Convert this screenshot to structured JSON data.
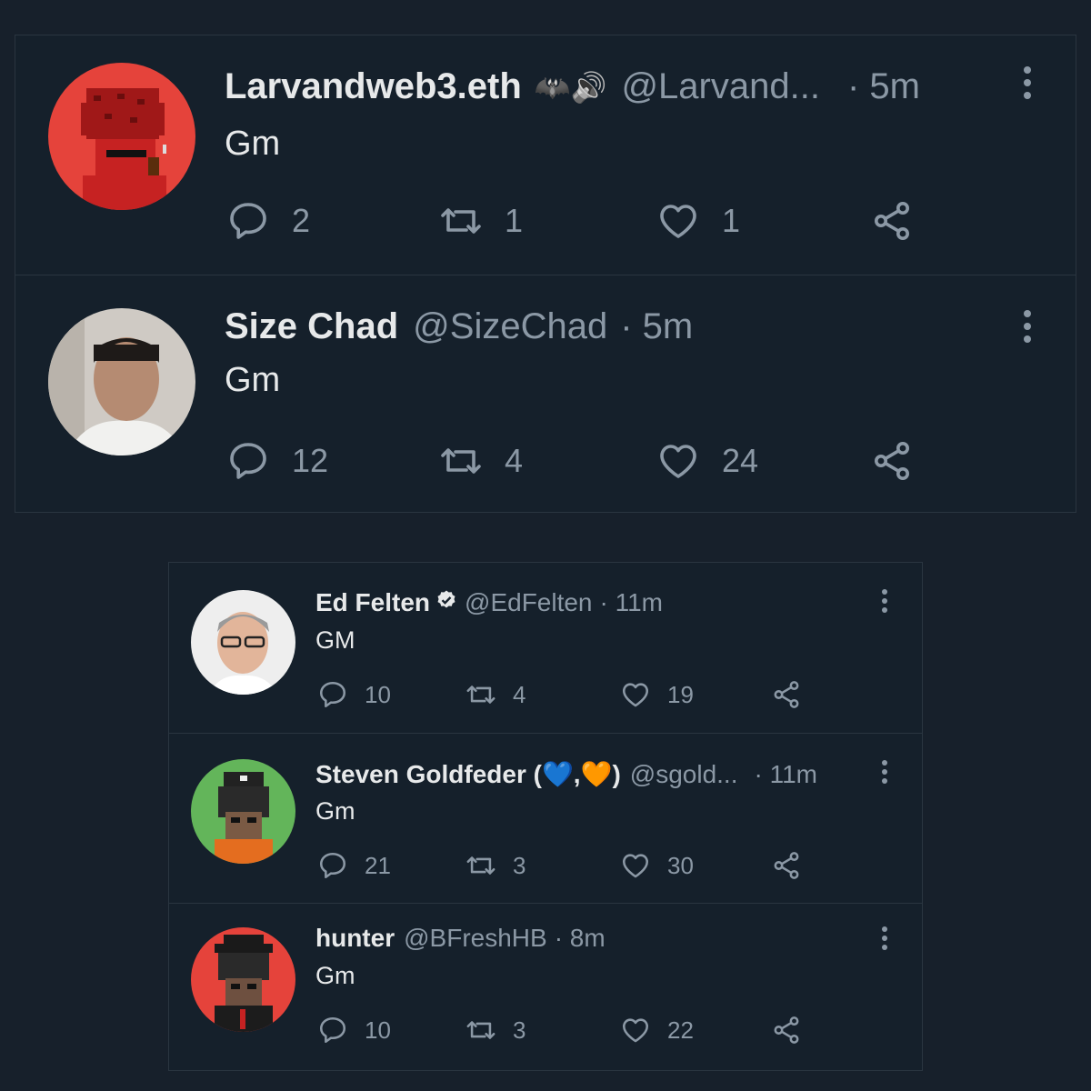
{
  "top_panel": {
    "tweets": [
      {
        "name": "Larvandweb3.eth",
        "name_emoji": "🦇🔊",
        "handle": "@Larvand...",
        "time": "· 5m",
        "text": "Gm",
        "avatar_bg": "#e5433b",
        "counts": {
          "reply": "2",
          "retweet": "1",
          "like": "1"
        }
      },
      {
        "name": "Size Chad",
        "handle": "@SizeChad",
        "time": "· 5m",
        "text": "Gm",
        "avatar_bg": "#9a9088",
        "counts": {
          "reply": "12",
          "retweet": "4",
          "like": "24"
        }
      }
    ]
  },
  "bottom_panel": {
    "tweets": [
      {
        "name": "Ed Felten",
        "handle": "@EdFelten",
        "time": "· 11m",
        "text": "GM",
        "avatar_bg": "#e9e9e9",
        "verified": true,
        "counts": {
          "reply": "10",
          "retweet": "4",
          "like": "19"
        }
      },
      {
        "name": "Steven Goldfeder (💙,🧡)",
        "handle": "@sgold...",
        "time": "· 11m",
        "text": "Gm",
        "avatar_bg": "#63b55a",
        "counts": {
          "reply": "21",
          "retweet": "3",
          "like": "30"
        }
      },
      {
        "name": "hunter",
        "handle": "@BFreshHB",
        "time": "· 8m",
        "text": "Gm",
        "avatar_bg": "#e5433b",
        "counts": {
          "reply": "10",
          "retweet": "3",
          "like": "22"
        }
      }
    ]
  },
  "colors": {
    "background": "#15202b",
    "text": "#e7e9ea",
    "muted": "#8b98a5",
    "verified": "#e7e9ea"
  },
  "icons": [
    "reply-icon",
    "retweet-icon",
    "like-icon",
    "share-icon",
    "more-icon",
    "verified-icon"
  ]
}
